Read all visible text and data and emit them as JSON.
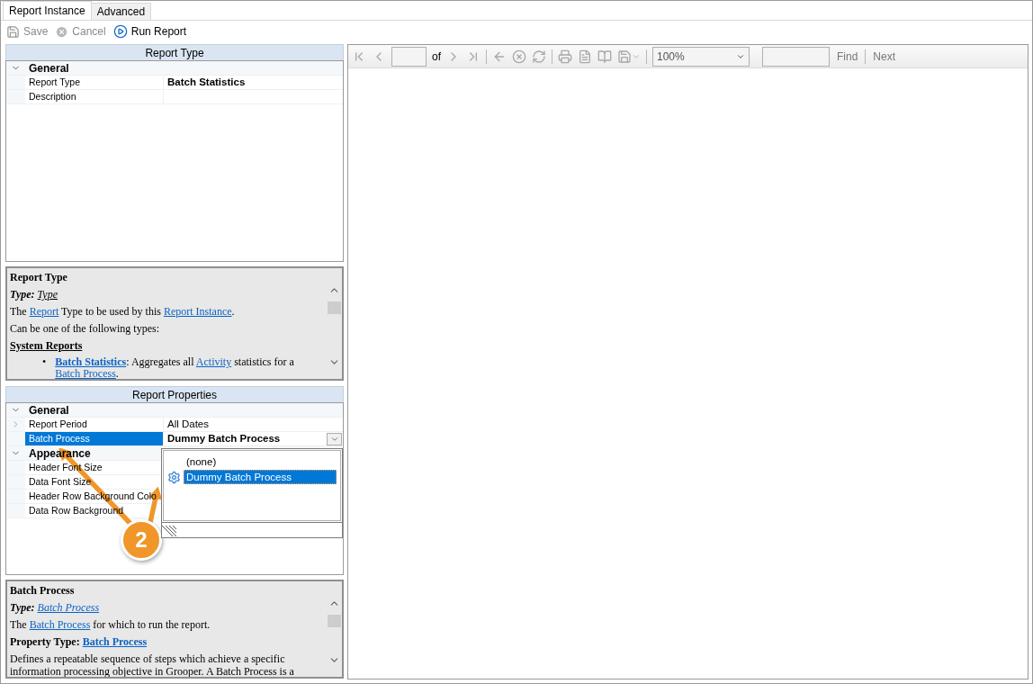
{
  "tabs": [
    {
      "label": "Report Instance",
      "selected": true
    },
    {
      "label": "Advanced",
      "selected": false
    }
  ],
  "toolbar": [
    {
      "label": "Save",
      "disabled": true
    },
    {
      "label": "Cancel",
      "disabled": true
    },
    {
      "label": "Run Report",
      "disabled": false
    }
  ],
  "report_type_panel": {
    "title": "Report Type",
    "categories": [
      {
        "name": "General",
        "expanded": true,
        "rows": [
          {
            "label": "Report Type",
            "value": "Batch Statistics",
            "bold": true,
            "selected": false
          },
          {
            "label": "Description",
            "selected": false
          }
        ]
      }
    ]
  },
  "report_type_help": {
    "lines": [
      {
        "kind": "title",
        "segments": [
          {
            "kind": "text",
            "text": "Report Type"
          }
        ]
      },
      {
        "kind": "type",
        "segments": [
          {
            "kind": "text",
            "text": "Type: "
          },
          {
            "kind": "term",
            "text": "Type"
          }
        ]
      },
      {
        "kind": "text",
        "segments": [
          {
            "kind": "text",
            "text": "The "
          },
          {
            "kind": "link",
            "text": "Report"
          },
          {
            "kind": "text",
            "text": " Type to be used by this "
          },
          {
            "kind": "link",
            "text": "Report Instance"
          },
          {
            "kind": "text",
            "text": "."
          }
        ]
      },
      {
        "kind": "text",
        "segments": [
          {
            "kind": "text",
            "text": "Can be one of the following types:"
          }
        ]
      },
      {
        "kind": "section",
        "segments": [
          {
            "kind": "text",
            "text": "System Reports"
          }
        ]
      },
      {
        "kind": "bullet",
        "bullet": "•",
        "segments": [
          {
            "kind": "strong",
            "text": "Batch Statistics"
          },
          {
            "kind": "text",
            "text": ": Aggregates all "
          },
          {
            "kind": "link",
            "text": "Activity"
          },
          {
            "kind": "text",
            "text": " statistics for a "
          },
          {
            "kind": "link",
            "text": "Batch Process"
          },
          {
            "kind": "text",
            "text": "."
          }
        ]
      }
    ]
  },
  "report_properties_panel": {
    "title": "Report Properties",
    "categories": [
      {
        "name": "General",
        "expanded": true,
        "rows": [
          {
            "label": "Report Period",
            "value": "All Dates",
            "bold": false,
            "selected": false,
            "expandable": true
          },
          {
            "label": "Batch Process",
            "value": "Dummy Batch Process",
            "bold": true,
            "selected": true,
            "dropdown": true
          }
        ]
      },
      {
        "name": "Appearance",
        "expanded": true,
        "rows": [
          {
            "label": "Header Font Size",
            "selected": false
          },
          {
            "label": "Data Font Size",
            "selected": false
          },
          {
            "label": "Header Row Background Colo",
            "selected": false
          },
          {
            "label": "Data Row Background",
            "selected": false
          }
        ]
      }
    ]
  },
  "dropdown_list": {
    "options": [
      {
        "label": "(none)",
        "selected": false
      },
      {
        "label": "Dummy Batch Process",
        "selected": true
      }
    ]
  },
  "batch_process_help": {
    "lines": [
      {
        "kind": "title",
        "segments": [
          {
            "kind": "text",
            "text": "Batch Process"
          }
        ]
      },
      {
        "kind": "type",
        "segments": [
          {
            "kind": "text",
            "text": "Type: "
          },
          {
            "kind": "link",
            "text": "Batch Process"
          }
        ]
      },
      {
        "kind": "text",
        "segments": [
          {
            "kind": "text",
            "text": "The "
          },
          {
            "kind": "link",
            "text": "Batch Process"
          },
          {
            "kind": "text",
            "text": " for which to run the report."
          }
        ]
      },
      {
        "kind": "property",
        "segments": [
          {
            "kind": "text",
            "text": "Property Type: "
          },
          {
            "kind": "link",
            "text": "Batch Process"
          }
        ]
      },
      {
        "kind": "text",
        "segments": [
          {
            "kind": "text",
            "text": "Defines a repeatable sequence of steps which achieve a specific information processing objective in Grooper. A Batch Process is a"
          }
        ]
      }
    ]
  },
  "callout": {
    "number": "2"
  },
  "viewer_toolbar": {
    "items": [
      {
        "kind": "button",
        "disabled": true
      },
      {
        "kind": "button",
        "disabled": true
      },
      {
        "kind": "page_field"
      },
      {
        "kind": "label",
        "text": "of"
      },
      {
        "kind": "button",
        "disabled": true
      },
      {
        "kind": "button",
        "disabled": true
      },
      {
        "kind": "separator"
      },
      {
        "kind": "button",
        "disabled": true
      },
      {
        "kind": "button",
        "disabled": true
      },
      {
        "kind": "button",
        "disabled": true
      },
      {
        "kind": "separator"
      },
      {
        "kind": "button",
        "disabled": true
      },
      {
        "kind": "button",
        "disabled": true
      },
      {
        "kind": "button",
        "disabled": true
      },
      {
        "kind": "button",
        "disabled": true
      },
      {
        "kind": "separator"
      },
      {
        "kind": "zoom",
        "value": "100%"
      },
      {
        "kind": "find_field"
      },
      {
        "kind": "link",
        "text": "Find",
        "disabled": true
      },
      {
        "kind": "separator"
      },
      {
        "kind": "link",
        "text": "Next",
        "disabled": true
      }
    ]
  }
}
